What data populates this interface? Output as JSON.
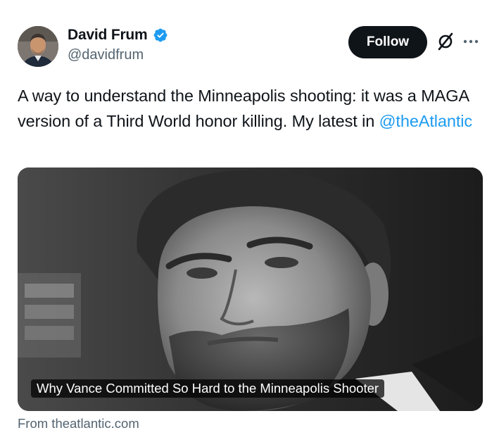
{
  "author": {
    "display_name": "David Frum",
    "handle": "@davidfrum",
    "verified": true,
    "avatar_icon": "avatar"
  },
  "actions": {
    "follow_label": "Follow",
    "grok_icon": "grok-slash-icon",
    "more_icon": "more-dots-icon"
  },
  "tweet": {
    "text_before_mention": "A way to understand the Minneapolis shooting: it was a MAGA version of a Third World honor killing. My latest in ",
    "mention": "@theAtlantic"
  },
  "card": {
    "title": "Why Vance Committed So Hard to the Minneapolis Shooter",
    "source": "From theatlantic.com"
  },
  "colors": {
    "text": "#0f1419",
    "secondary": "#536471",
    "link": "#1d9bf0",
    "follow_bg": "#0f1419"
  }
}
